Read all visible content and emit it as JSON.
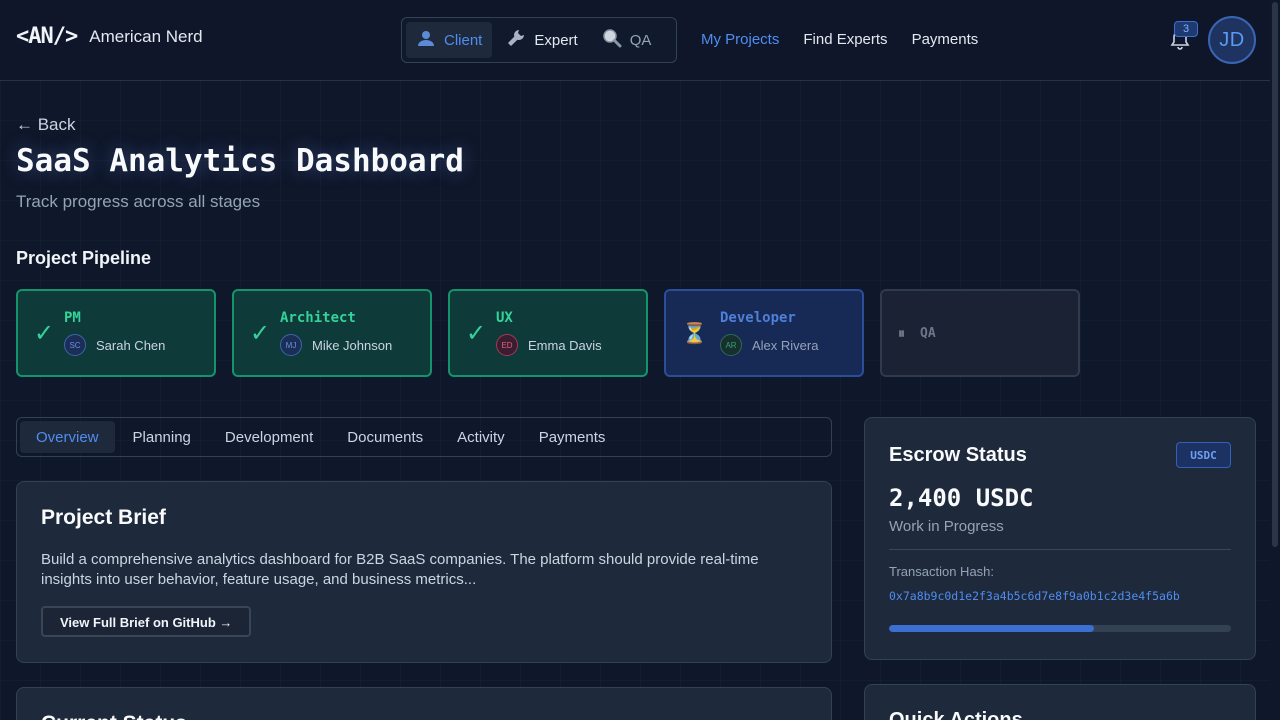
{
  "header": {
    "logo_mark": "<AN/>",
    "logo_name": "American Nerd",
    "roles": [
      {
        "label": "Client",
        "icon": "user-icon"
      },
      {
        "label": "Expert",
        "icon": "wrench-icon"
      },
      {
        "label": "QA",
        "icon": "magnifier-icon"
      }
    ],
    "nav": [
      "My Projects",
      "Find Experts",
      "Payments"
    ],
    "notification_count": "3",
    "avatar_initials": "JD"
  },
  "page": {
    "back_label": "← Back",
    "title": "SaaS Analytics Dashboard",
    "subtitle": "Track progress across all stages",
    "pipeline_title": "Project Pipeline"
  },
  "pipeline": [
    {
      "stage": "PM",
      "status": "done",
      "status_glyph": "✓",
      "person": "Sarah Chen",
      "initials": "SC"
    },
    {
      "stage": "Architect",
      "status": "done",
      "status_glyph": "✓",
      "person": "Mike Johnson",
      "initials": "MJ"
    },
    {
      "stage": "UX",
      "status": "done",
      "status_glyph": "✓",
      "person": "Emma Davis",
      "initials": "ED"
    },
    {
      "stage": "Developer",
      "status": "in-progress",
      "status_glyph": "⏳",
      "person": "Alex Rivera",
      "initials": "AR"
    },
    {
      "stage": "QA",
      "status": "pending",
      "status_glyph": "⏸",
      "person": "",
      "initials": ""
    }
  ],
  "tabs": [
    "Overview",
    "Planning",
    "Development",
    "Documents",
    "Activity",
    "Payments"
  ],
  "brief": {
    "title": "Project Brief",
    "text": "Build a comprehensive analytics dashboard for B2B SaaS companies. The platform should provide real-time insights into user behavior, feature usage, and business metrics...",
    "button": "View Full Brief on GitHub →"
  },
  "status_card": {
    "title": "Current Status"
  },
  "escrow": {
    "title": "Escrow Status",
    "badge": "USDC",
    "amount": "2,400 USDC",
    "state": "Work in Progress",
    "hash_label": "Transaction Hash:",
    "hash": "0x7a8b9c0d1e2f3a4b5c6d7e8f9a0b1c2d3e4f5a6b",
    "progress": 0.6
  },
  "quick_actions": {
    "title": "Quick Actions"
  },
  "colors": {
    "accent": "#4f8df0",
    "success": "#34d399",
    "background": "#0f172a",
    "card": "#1e293b"
  }
}
